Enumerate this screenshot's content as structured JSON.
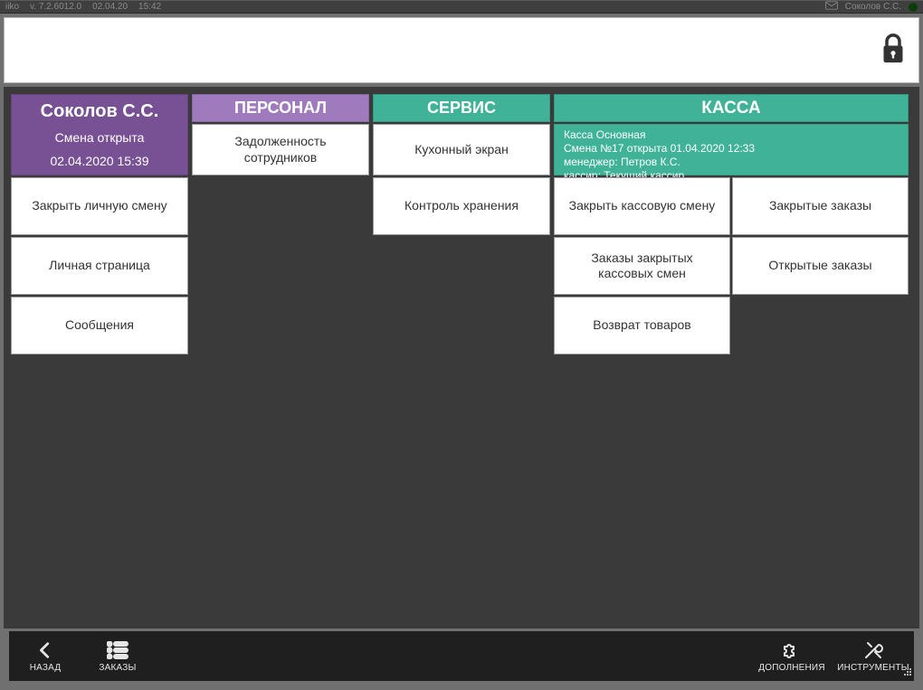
{
  "statusbar": {
    "app": "iiko",
    "version": "v. 7.2.6012.0",
    "date": "02.04.20",
    "time": "15:42",
    "user": "Соколов С.С."
  },
  "columns": {
    "user": {
      "title": "Соколов С.С.",
      "shift_label": "Смена открыта",
      "shift_time": "02.04.2020 15:39",
      "close_personal_shift": "Закрыть личную смену",
      "personal_page": "Личная страница",
      "messages": "Сообщения"
    },
    "staff": {
      "title": "ПЕРСОНАЛ",
      "debts": "Задолженность сотрудников"
    },
    "service": {
      "title": "СЕРВИС",
      "kitchen_screen": "Кухонный экран",
      "storage_control": "Контроль хранения"
    },
    "cash": {
      "title": "КАССА",
      "info": {
        "name": "Касса Основная",
        "shift": "Смена №17 открыта 01.04.2020 12:33",
        "manager": "менеджер: Петров К.С.",
        "cashier_label": "кассир: ",
        "cashier_link": "Текущий кассир"
      },
      "close_cash_shift": "Закрыть кассовую смену",
      "closed_orders": "Закрытые заказы",
      "closed_shift_orders": "Заказы закрытых кассовых смен",
      "open_orders": "Открытые заказы",
      "return_goods": "Возврат товаров"
    }
  },
  "bottombar": {
    "back": "НАЗАД",
    "orders": "ЗАКАЗЫ",
    "addons": "ДОПОЛНЕНИЯ",
    "tools": "ИНСТРУМЕНТЫ"
  }
}
